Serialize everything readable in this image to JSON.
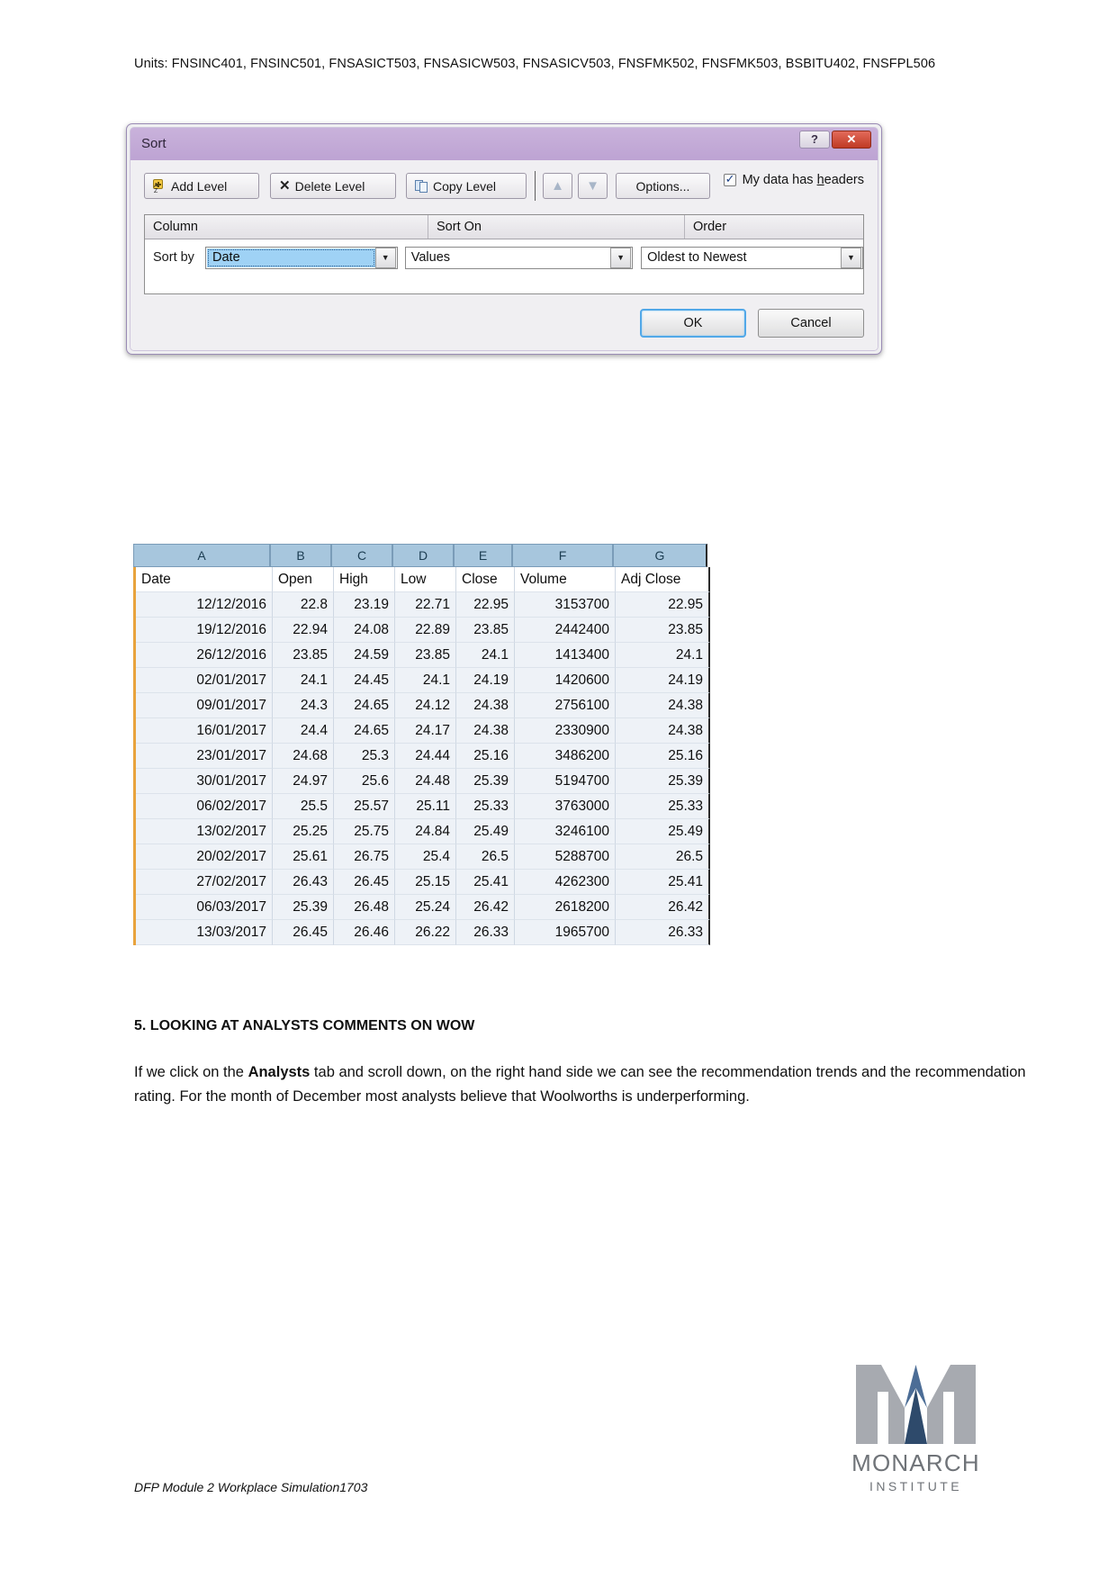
{
  "header": {
    "units_line": "Units: FNSINC401, FNSINC501, FNSASICT503, FNSASICW503, FNSASICV503, FNSFMK502, FNSFMK503, BSBITU402, FNSFPL506"
  },
  "sort_dialog": {
    "title": "Sort",
    "help_label": "?",
    "close_label": "✕",
    "toolbar": {
      "add_level": "Add Level",
      "add_level_prefix": "",
      "add_level_underline": "A",
      "delete_level": "Delete Level",
      "delete_level_underline": "D",
      "copy_level": "Copy Level",
      "copy_level_underline": "C",
      "move_up": "▲",
      "move_down": "▼",
      "options": "Options...",
      "options_underline": "O",
      "az_icon_label": "A\nZ"
    },
    "headers_checkbox": {
      "label_before": "My data has ",
      "label_underline": "h",
      "label_after": "eaders",
      "checked": true
    },
    "columns": {
      "column": "Column",
      "sort_on": "Sort On",
      "order": "Order"
    },
    "row": {
      "sort_by_label": "Sort by",
      "column_value": "Date",
      "sort_on_value": "Values",
      "order_value": "Oldest to Newest",
      "dropdown_glyph": "▼"
    },
    "buttons": {
      "ok": "OK",
      "cancel": "Cancel"
    }
  },
  "spreadsheet": {
    "column_letters": [
      "A",
      "B",
      "C",
      "D",
      "E",
      "F",
      "G"
    ],
    "headers": [
      "Date",
      "Open",
      "High",
      "Low",
      "Close",
      "Volume",
      "Adj Close"
    ],
    "rows": [
      [
        "12/12/2016",
        "22.8",
        "23.19",
        "22.71",
        "22.95",
        "3153700",
        "22.95"
      ],
      [
        "19/12/2016",
        "22.94",
        "24.08",
        "22.89",
        "23.85",
        "2442400",
        "23.85"
      ],
      [
        "26/12/2016",
        "23.85",
        "24.59",
        "23.85",
        "24.1",
        "1413400",
        "24.1"
      ],
      [
        "02/01/2017",
        "24.1",
        "24.45",
        "24.1",
        "24.19",
        "1420600",
        "24.19"
      ],
      [
        "09/01/2017",
        "24.3",
        "24.65",
        "24.12",
        "24.38",
        "2756100",
        "24.38"
      ],
      [
        "16/01/2017",
        "24.4",
        "24.65",
        "24.17",
        "24.38",
        "2330900",
        "24.38"
      ],
      [
        "23/01/2017",
        "24.68",
        "25.3",
        "24.44",
        "25.16",
        "3486200",
        "25.16"
      ],
      [
        "30/01/2017",
        "24.97",
        "25.6",
        "24.48",
        "25.39",
        "5194700",
        "25.39"
      ],
      [
        "06/02/2017",
        "25.5",
        "25.57",
        "25.11",
        "25.33",
        "3763000",
        "25.33"
      ],
      [
        "13/02/2017",
        "25.25",
        "25.75",
        "24.84",
        "25.49",
        "3246100",
        "25.49"
      ],
      [
        "20/02/2017",
        "25.61",
        "26.75",
        "25.4",
        "26.5",
        "5288700",
        "26.5"
      ],
      [
        "27/02/2017",
        "26.43",
        "26.45",
        "25.15",
        "25.41",
        "4262300",
        "25.41"
      ],
      [
        "06/03/2017",
        "25.39",
        "26.48",
        "25.24",
        "26.42",
        "2618200",
        "26.42"
      ],
      [
        "13/03/2017",
        "26.45",
        "26.46",
        "26.22",
        "26.33",
        "1965700",
        "26.33"
      ]
    ]
  },
  "content": {
    "section_heading": "5. LOOKING AT ANALYSTS COMMENTS ON WOW",
    "paragraph_part1": "If we click on the ",
    "paragraph_bold": "Analysts",
    "paragraph_part2": " tab and scroll down, on the right hand side we can see the recommendation trends and the recommendation rating. For the month of December most analysts believe that Woolworths is underperforming."
  },
  "footer": {
    "doc_reference": "DFP Module 2 Workplace Simulation1703",
    "logo_name": "MONARCH",
    "logo_subtitle": "INSTITUTE"
  }
}
